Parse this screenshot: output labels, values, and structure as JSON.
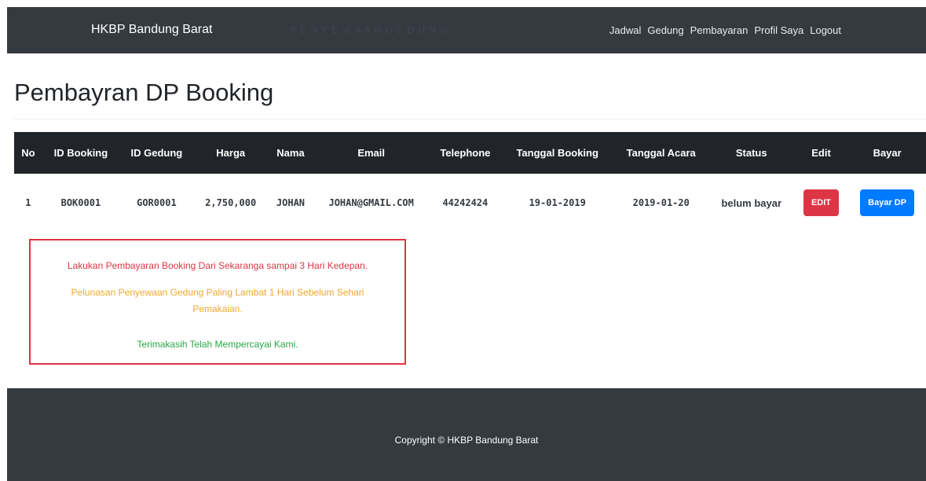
{
  "navbar": {
    "brand": "HKBP Bandung Barat",
    "ghost_text": "P E N Y E W A A N   G E D U N G",
    "links": [
      "Jadwal",
      "Gedung",
      "Pembayaran",
      "Profil Saya",
      "Logout"
    ]
  },
  "page": {
    "title": "Pembayran DP Booking"
  },
  "table": {
    "headers": [
      "No",
      "ID Booking",
      "ID Gedung",
      "Harga",
      "Nama",
      "Email",
      "Telephone",
      "Tanggal Booking",
      "Tanggal Acara",
      "Status",
      "Edit",
      "Bayar"
    ],
    "rows": [
      {
        "no": "1",
        "id_booking": "BOK0001",
        "id_gedung": "GOR0001",
        "harga": "2,750,000",
        "nama": "JOHAN",
        "email": "JOHAN@GMAIL.COM",
        "telephone": "44242424",
        "tanggal_booking": "19-01-2019",
        "tanggal_acara": "2019-01-20",
        "status": "belum bayar",
        "edit_label": "EDIT",
        "bayar_label": "Bayar DP"
      }
    ]
  },
  "notice": {
    "line1": "Lakukan Pembayaran Booking Dari Sekaranga sampai 3 Hari Kedepan.",
    "line2": "Pelunasan Penyewaan Gedung Paling Lambat 1 Hari Sebelum Sehari Pemakaian.",
    "line3": "Terimakasih Telah Mempercayai Kami."
  },
  "footer": {
    "copyright": "Copyright © HKBP Bandung Barat"
  },
  "colors": {
    "navbar_bg": "#343a40",
    "table_header_bg": "#212529",
    "danger": "#dc3545",
    "primary": "#007bff",
    "warning_text": "#f0a830",
    "success_text": "#28a745"
  }
}
